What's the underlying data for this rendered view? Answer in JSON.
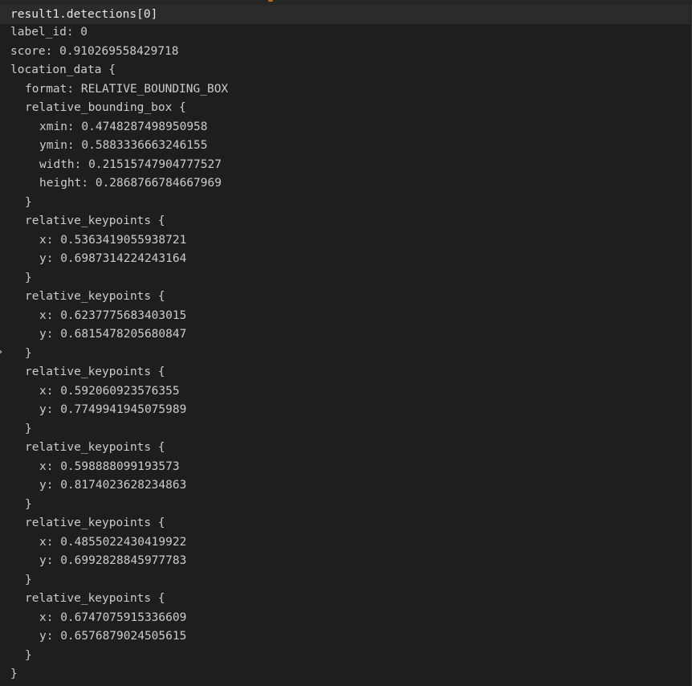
{
  "header": {
    "title": "result1.detections[0]"
  },
  "lines": {
    "l1": "label_id: 0",
    "l2": "score: 0.910269558429718",
    "l3": "location_data {",
    "l4": "format: RELATIVE_BOUNDING_BOX",
    "l5": "relative_bounding_box {",
    "l6": "xmin: 0.4748287498950958",
    "l7": "ymin: 0.5883336663246155",
    "l8": "width: 0.21515747904777527",
    "l9": "height: 0.2868766784667969",
    "l10": "}",
    "l11": "relative_keypoints {",
    "l12": "x: 0.5363419055938721",
    "l13": "y: 0.6987314224243164",
    "l14": "}",
    "l15": "relative_keypoints {",
    "l16": "x: 0.6237775683403015",
    "l17": "y: 0.6815478205680847",
    "l18": "}",
    "l19": "relative_keypoints {",
    "l20": "x: 0.592060923576355",
    "l21": "y: 0.7749941945075989",
    "l22": "}",
    "l23": "relative_keypoints {",
    "l24": "x: 0.598888099193573",
    "l25": "y: 0.8174023628234863",
    "l26": "}",
    "l27": "relative_keypoints {",
    "l28": "x: 0.4855022430419922",
    "l29": "y: 0.6992828845977783",
    "l30": "}",
    "l31": "relative_keypoints {",
    "l32": "x: 0.6747075915336609",
    "l33": "y: 0.6576879024505615",
    "l34": "}",
    "l35": "}"
  },
  "icons": {
    "gutter": "chevron-right-icon"
  },
  "colors": {
    "background": "#1e1e1e",
    "header_background": "#2b2b2b",
    "text": "#cccccc",
    "header_text": "#e6e6e6"
  }
}
